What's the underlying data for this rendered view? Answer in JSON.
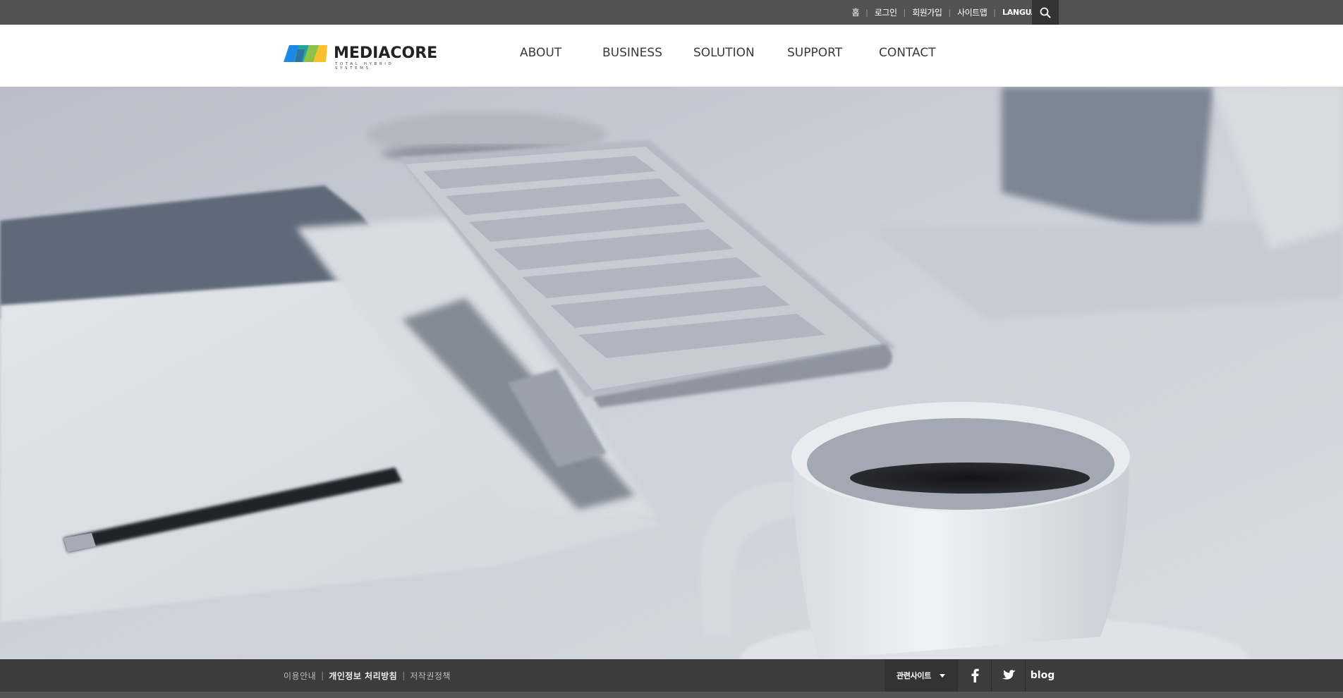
{
  "utility_bar": {
    "links": [
      "홈",
      "로그인",
      "회원가입",
      "사이트맵"
    ],
    "language_label": "LANGUAGE",
    "search_icon": "search-icon"
  },
  "header": {
    "logo": {
      "name": "MEDIACORE",
      "tagline": "TOTAL HYBRID SYSTEMS"
    },
    "nav": [
      "ABOUT",
      "BUSINESS",
      "SOLUTION",
      "SUPPORT",
      "CONTACT"
    ]
  },
  "footer": {
    "links": [
      {
        "label": "이용안내"
      },
      {
        "label": "개인정보 처리방침"
      },
      {
        "label": "저작권정책"
      }
    ],
    "related_sites_label": "관련사이트",
    "social": {
      "facebook_icon": "facebook-icon",
      "twitter_icon": "twitter-icon",
      "blog_label": "blog"
    }
  },
  "colors": {
    "topbar": "#525252",
    "search_bg": "#333333",
    "footer": "#3c3c3c",
    "nav_text": "#3a3a3a"
  }
}
